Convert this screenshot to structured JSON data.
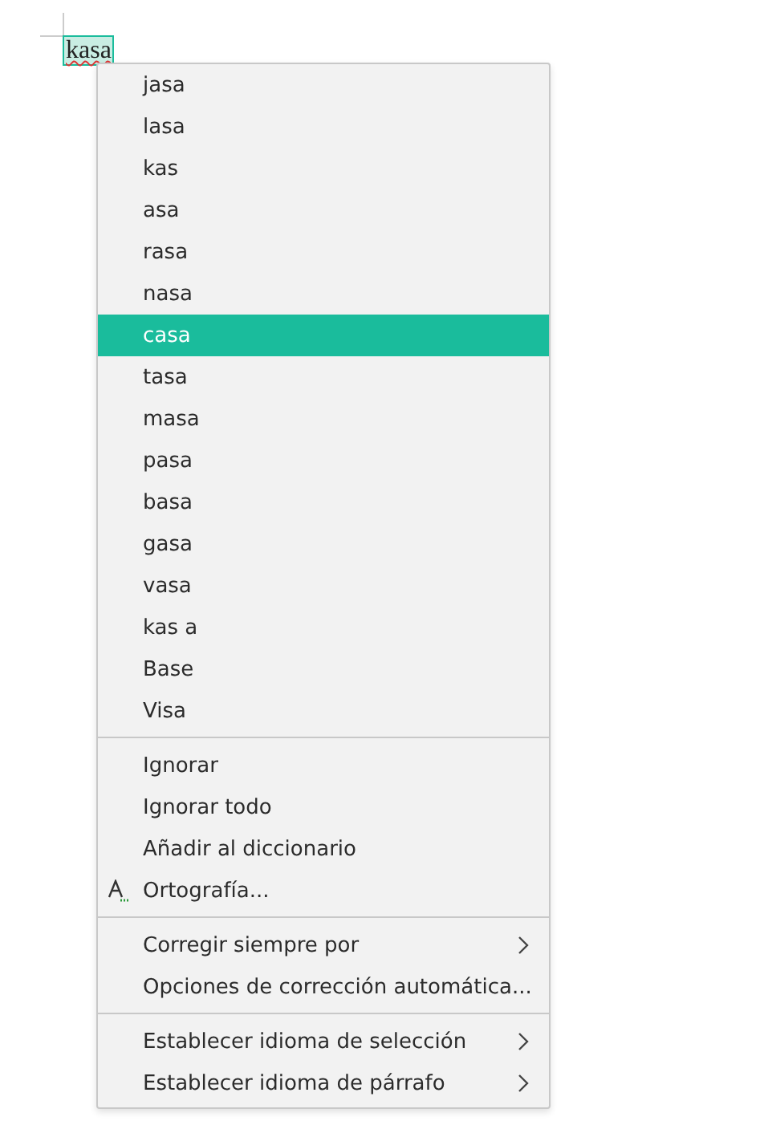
{
  "document": {
    "word": "kasa",
    "misspelled": true,
    "word_selected": true
  },
  "context_menu": {
    "sections": [
      {
        "items": [
          {
            "label": "jasa",
            "kind": "plain",
            "selected": false
          },
          {
            "label": "lasa",
            "kind": "plain",
            "selected": false
          },
          {
            "label": "kas",
            "kind": "plain",
            "selected": false
          },
          {
            "label": "asa",
            "kind": "plain",
            "selected": false
          },
          {
            "label": "rasa",
            "kind": "plain",
            "selected": false
          },
          {
            "label": "nasa",
            "kind": "plain",
            "selected": false
          },
          {
            "label": "casa",
            "kind": "plain",
            "selected": true
          },
          {
            "label": "tasa",
            "kind": "plain",
            "selected": false
          },
          {
            "label": "masa",
            "kind": "plain",
            "selected": false
          },
          {
            "label": "pasa",
            "kind": "plain",
            "selected": false
          },
          {
            "label": "basa",
            "kind": "plain",
            "selected": false
          },
          {
            "label": "gasa",
            "kind": "plain",
            "selected": false
          },
          {
            "label": "vasa",
            "kind": "plain",
            "selected": false
          },
          {
            "label": "kas a",
            "kind": "plain",
            "selected": false
          },
          {
            "label": "Base",
            "kind": "plain",
            "selected": false
          },
          {
            "label": "Visa",
            "kind": "plain",
            "selected": false
          }
        ]
      },
      {
        "items": [
          {
            "label": "Ignorar",
            "kind": "plain",
            "selected": false
          },
          {
            "label": "Ignorar todo",
            "kind": "plain",
            "selected": false
          },
          {
            "label": "Añadir al diccionario",
            "kind": "plain",
            "selected": false
          },
          {
            "label": "Ortografía...",
            "kind": "icon",
            "selected": false
          }
        ]
      },
      {
        "items": [
          {
            "label": "Corregir siempre por",
            "kind": "submenu",
            "selected": false
          },
          {
            "label": "Opciones de corrección automática...",
            "kind": "plain",
            "selected": false
          }
        ]
      },
      {
        "items": [
          {
            "label": "Establecer idioma de selección",
            "kind": "submenu",
            "selected": false
          },
          {
            "label": "Establecer idioma de párrafo",
            "kind": "submenu",
            "selected": false
          }
        ]
      }
    ]
  }
}
